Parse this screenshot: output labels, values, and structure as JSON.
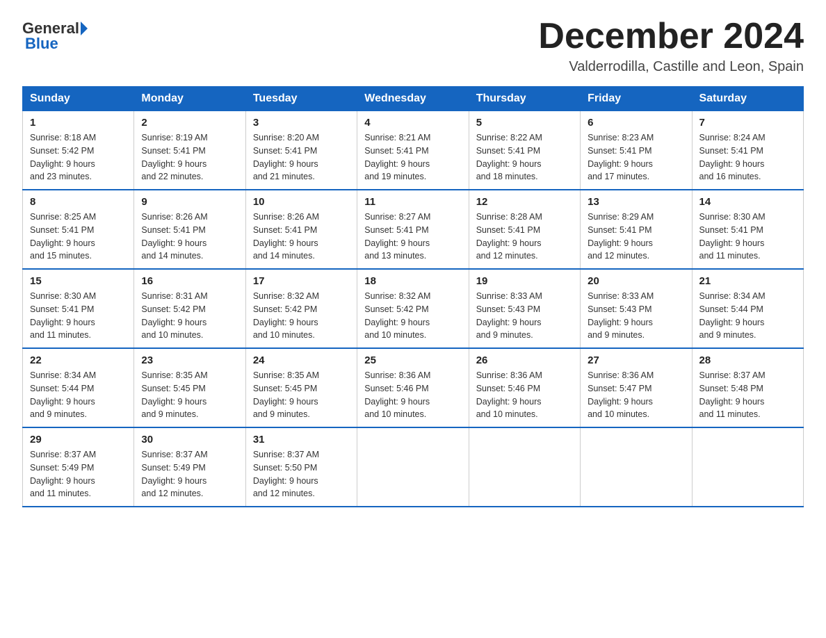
{
  "logo": {
    "general": "General",
    "blue": "Blue"
  },
  "header": {
    "month": "December 2024",
    "location": "Valderrodilla, Castille and Leon, Spain"
  },
  "weekdays": [
    "Sunday",
    "Monday",
    "Tuesday",
    "Wednesday",
    "Thursday",
    "Friday",
    "Saturday"
  ],
  "weeks": [
    [
      {
        "day": "1",
        "sunrise": "8:18 AM",
        "sunset": "5:42 PM",
        "daylight": "9 hours and 23 minutes."
      },
      {
        "day": "2",
        "sunrise": "8:19 AM",
        "sunset": "5:41 PM",
        "daylight": "9 hours and 22 minutes."
      },
      {
        "day": "3",
        "sunrise": "8:20 AM",
        "sunset": "5:41 PM",
        "daylight": "9 hours and 21 minutes."
      },
      {
        "day": "4",
        "sunrise": "8:21 AM",
        "sunset": "5:41 PM",
        "daylight": "9 hours and 19 minutes."
      },
      {
        "day": "5",
        "sunrise": "8:22 AM",
        "sunset": "5:41 PM",
        "daylight": "9 hours and 18 minutes."
      },
      {
        "day": "6",
        "sunrise": "8:23 AM",
        "sunset": "5:41 PM",
        "daylight": "9 hours and 17 minutes."
      },
      {
        "day": "7",
        "sunrise": "8:24 AM",
        "sunset": "5:41 PM",
        "daylight": "9 hours and 16 minutes."
      }
    ],
    [
      {
        "day": "8",
        "sunrise": "8:25 AM",
        "sunset": "5:41 PM",
        "daylight": "9 hours and 15 minutes."
      },
      {
        "day": "9",
        "sunrise": "8:26 AM",
        "sunset": "5:41 PM",
        "daylight": "9 hours and 14 minutes."
      },
      {
        "day": "10",
        "sunrise": "8:26 AM",
        "sunset": "5:41 PM",
        "daylight": "9 hours and 14 minutes."
      },
      {
        "day": "11",
        "sunrise": "8:27 AM",
        "sunset": "5:41 PM",
        "daylight": "9 hours and 13 minutes."
      },
      {
        "day": "12",
        "sunrise": "8:28 AM",
        "sunset": "5:41 PM",
        "daylight": "9 hours and 12 minutes."
      },
      {
        "day": "13",
        "sunrise": "8:29 AM",
        "sunset": "5:41 PM",
        "daylight": "9 hours and 12 minutes."
      },
      {
        "day": "14",
        "sunrise": "8:30 AM",
        "sunset": "5:41 PM",
        "daylight": "9 hours and 11 minutes."
      }
    ],
    [
      {
        "day": "15",
        "sunrise": "8:30 AM",
        "sunset": "5:41 PM",
        "daylight": "9 hours and 11 minutes."
      },
      {
        "day": "16",
        "sunrise": "8:31 AM",
        "sunset": "5:42 PM",
        "daylight": "9 hours and 10 minutes."
      },
      {
        "day": "17",
        "sunrise": "8:32 AM",
        "sunset": "5:42 PM",
        "daylight": "9 hours and 10 minutes."
      },
      {
        "day": "18",
        "sunrise": "8:32 AM",
        "sunset": "5:42 PM",
        "daylight": "9 hours and 10 minutes."
      },
      {
        "day": "19",
        "sunrise": "8:33 AM",
        "sunset": "5:43 PM",
        "daylight": "9 hours and 9 minutes."
      },
      {
        "day": "20",
        "sunrise": "8:33 AM",
        "sunset": "5:43 PM",
        "daylight": "9 hours and 9 minutes."
      },
      {
        "day": "21",
        "sunrise": "8:34 AM",
        "sunset": "5:44 PM",
        "daylight": "9 hours and 9 minutes."
      }
    ],
    [
      {
        "day": "22",
        "sunrise": "8:34 AM",
        "sunset": "5:44 PM",
        "daylight": "9 hours and 9 minutes."
      },
      {
        "day": "23",
        "sunrise": "8:35 AM",
        "sunset": "5:45 PM",
        "daylight": "9 hours and 9 minutes."
      },
      {
        "day": "24",
        "sunrise": "8:35 AM",
        "sunset": "5:45 PM",
        "daylight": "9 hours and 9 minutes."
      },
      {
        "day": "25",
        "sunrise": "8:36 AM",
        "sunset": "5:46 PM",
        "daylight": "9 hours and 10 minutes."
      },
      {
        "day": "26",
        "sunrise": "8:36 AM",
        "sunset": "5:46 PM",
        "daylight": "9 hours and 10 minutes."
      },
      {
        "day": "27",
        "sunrise": "8:36 AM",
        "sunset": "5:47 PM",
        "daylight": "9 hours and 10 minutes."
      },
      {
        "day": "28",
        "sunrise": "8:37 AM",
        "sunset": "5:48 PM",
        "daylight": "9 hours and 11 minutes."
      }
    ],
    [
      {
        "day": "29",
        "sunrise": "8:37 AM",
        "sunset": "5:49 PM",
        "daylight": "9 hours and 11 minutes."
      },
      {
        "day": "30",
        "sunrise": "8:37 AM",
        "sunset": "5:49 PM",
        "daylight": "9 hours and 12 minutes."
      },
      {
        "day": "31",
        "sunrise": "8:37 AM",
        "sunset": "5:50 PM",
        "daylight": "9 hours and 12 minutes."
      },
      null,
      null,
      null,
      null
    ]
  ],
  "labels": {
    "sunrise": "Sunrise:",
    "sunset": "Sunset:",
    "daylight": "Daylight:"
  }
}
